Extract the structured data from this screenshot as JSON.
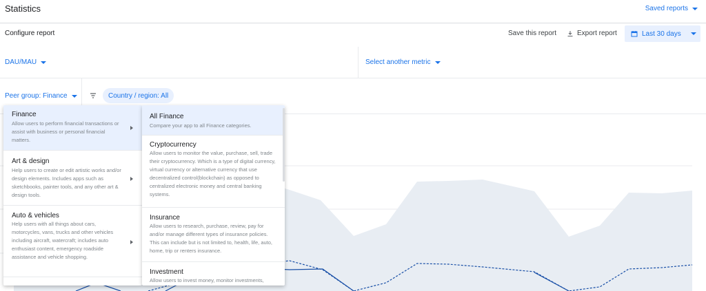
{
  "header": {
    "title": "Statistics",
    "saved_reports": "Saved reports"
  },
  "config": {
    "label": "Configure report",
    "save": "Save this report",
    "export": "Export report",
    "date_range": "Last 30 days"
  },
  "metrics": {
    "primary": "DAU/MAU",
    "secondary": "Select another metric"
  },
  "filters": {
    "peer_group": "Peer group: Finance",
    "country": "Country / region: All"
  },
  "categories": [
    {
      "label": "Finance",
      "desc": "Allow users to perform financial transactions or assist with business or personal financial matters.",
      "selected": true
    },
    {
      "label": "Art & design",
      "desc": "Help users to create or edit artistic works and/or design elements. Includes apps such as sketchbooks, painter tools, and any other art & design tools.",
      "selected": false
    },
    {
      "label": "Auto & vehicles",
      "desc": "Help users with all things about cars, motorcycles, vans, trucks and other vehicles including aircraft, watercraft; includes auto enthusiast content, emergency roadside assistance and vehicle shopping.",
      "selected": false
    }
  ],
  "subcategories": [
    {
      "label": "All Finance",
      "desc": "Compare your app to all Finance categories.",
      "selected": true
    },
    {
      "label": "Cryptocurrency",
      "desc": "Allow users to monitor the value, purchase, sell, trade their cryptocurrency. Which is a type of digital currency, virtual currency or alternative currency that use decentralized control(blockchain) as opposed to centralized electronic money and central banking systems.",
      "selected": false
    },
    {
      "label": "Insurance",
      "desc": "Allow users to research, purchase, review, pay for and/or manage different types of insurance policies. This can include but is not limited to, health, life, auto, home, trip or renters insurance.",
      "selected": false
    },
    {
      "label": "Investment",
      "desc": "Allow users to invest money, monitor investments,",
      "selected": false
    }
  ],
  "colors": {
    "accent": "#1a73e8",
    "chip_bg": "#e8f0fe",
    "area": "#e8edf3",
    "line": "#174ea6"
  },
  "icons": {
    "saved": "chevron-down-icon",
    "export": "download-icon",
    "date": "calendar-icon",
    "filter": "filter-icon",
    "submenu": "chevron-right-icon"
  }
}
